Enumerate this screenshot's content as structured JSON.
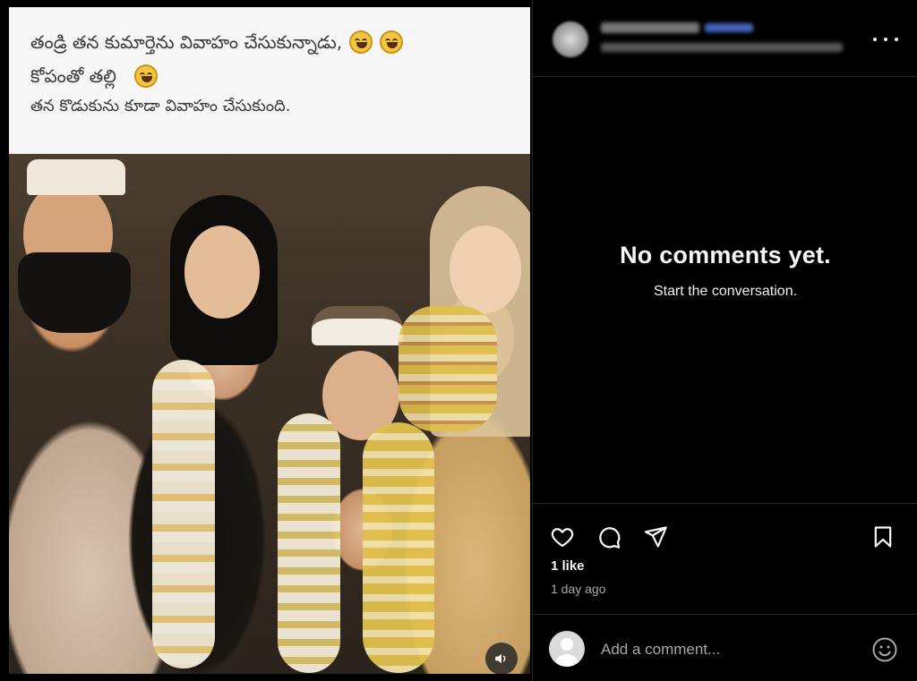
{
  "post": {
    "caption_lines": [
      "తండ్రి తన కుమార్తెను వివాహం చేసుకున్నాడు,",
      "కోపంతో తల్లి",
      "తన కొడుకును కూడా వివాహం చేసుకుంది."
    ],
    "emoji_name": "grinning-squinting-face-emoji"
  },
  "comments": {
    "empty_title": "No comments yet.",
    "empty_subtitle": "Start the conversation."
  },
  "engagement": {
    "likes_text": "1 like",
    "time_text": "1 day ago"
  },
  "composer": {
    "placeholder": "Add a comment..."
  },
  "icons": {
    "like": "heart-icon",
    "comment": "speech-bubble-icon",
    "share": "paper-plane-icon",
    "save": "bookmark-icon",
    "more": "more-options-icon",
    "volume": "speaker-icon",
    "emoji": "smiley-icon"
  },
  "colors": {
    "background": "#000000",
    "caption_bg": "#f6f6f6",
    "caption_text": "#3a3a3a",
    "text_primary": "#f5f5f5",
    "text_secondary": "#a8a8a8",
    "divider": "#262626"
  }
}
